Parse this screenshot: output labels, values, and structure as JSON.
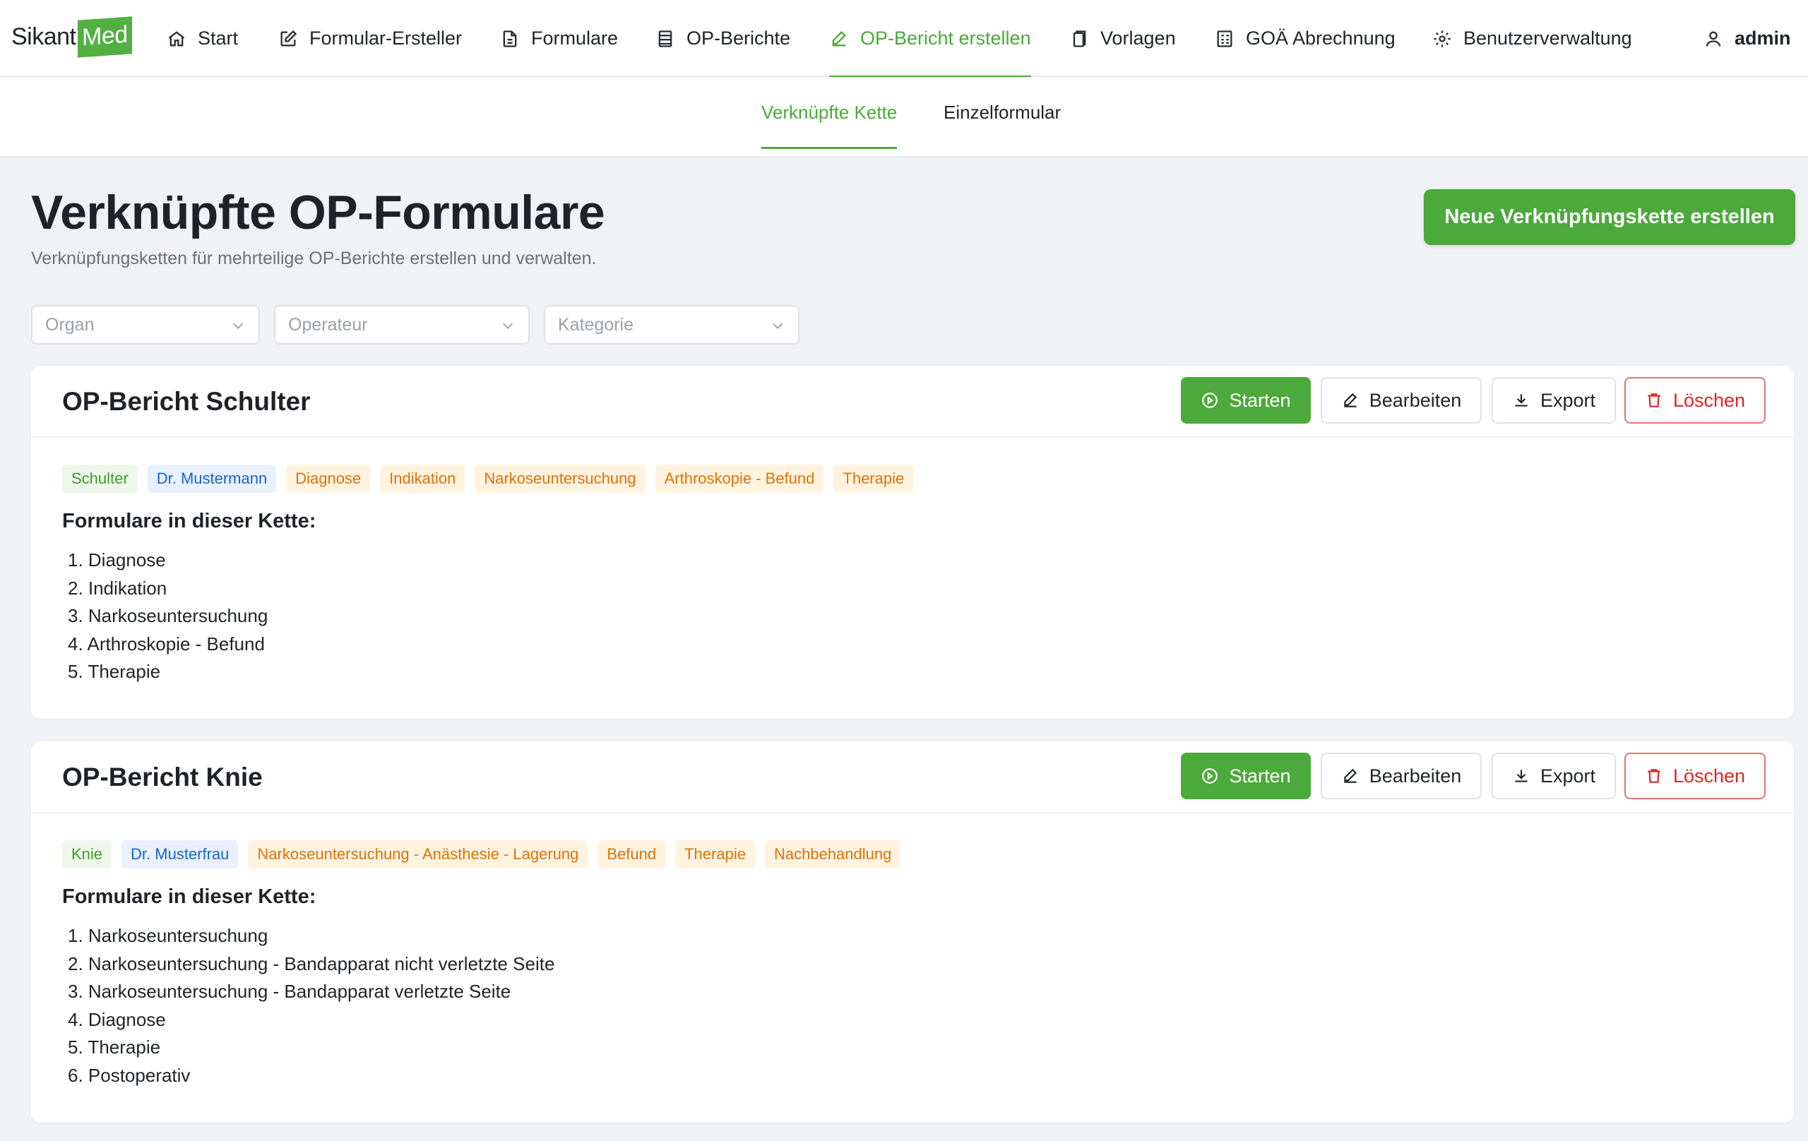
{
  "logo": {
    "part1": "Sikant",
    "part2": "Med"
  },
  "nav": {
    "items": [
      {
        "label": "Start",
        "icon": "home-icon"
      },
      {
        "label": "Formular-Ersteller",
        "icon": "edit-square-icon"
      },
      {
        "label": "Formulare",
        "icon": "document-icon"
      },
      {
        "label": "OP-Berichte",
        "icon": "list-document-icon"
      },
      {
        "label": "OP-Bericht erstellen",
        "icon": "pencil-icon"
      },
      {
        "label": "Vorlagen",
        "icon": "copy-icon"
      },
      {
        "label": "GOÄ Abrechnung",
        "icon": "calculator-icon"
      },
      {
        "label": "Benutzerverwaltung",
        "icon": "gear-icon"
      }
    ],
    "user": {
      "label": "admin",
      "icon": "user-icon"
    },
    "accent_color": "#4ca93b"
  },
  "subnav": {
    "tabs": [
      {
        "label": "Verknüpfte Kette"
      },
      {
        "label": "Einzelformular"
      }
    ]
  },
  "header": {
    "title": "Verknüpfte OP-Formulare",
    "subtitle": "Verknüpfungsketten für mehrteilige OP-Berichte erstellen und verwalten.",
    "create_button": "Neue Verknüpfungskette erstellen"
  },
  "filters": {
    "organ_placeholder": "Organ",
    "operateur_placeholder": "Operateur",
    "kategorie_placeholder": "Kategorie"
  },
  "actions": {
    "start": "Starten",
    "edit": "Bearbeiten",
    "export": "Export",
    "delete": "Löschen"
  },
  "chains": [
    {
      "title": "OP-Bericht Schulter",
      "tags": [
        {
          "label": "Schulter",
          "kind": "organ"
        },
        {
          "label": "Dr. Mustermann",
          "kind": "operateur"
        },
        {
          "label": "Diagnose",
          "kind": "kategorie"
        },
        {
          "label": "Indikation",
          "kind": "kategorie"
        },
        {
          "label": "Narkoseuntersuchung",
          "kind": "kategorie"
        },
        {
          "label": "Arthroskopie - Befund",
          "kind": "kategorie"
        },
        {
          "label": "Therapie",
          "kind": "kategorie"
        }
      ],
      "list_title": "Formulare in dieser Kette:",
      "forms": [
        "1. Diagnose",
        "2. Indikation",
        "3. Narkoseuntersuchung",
        "4. Arthroskopie - Befund",
        "5. Therapie"
      ]
    },
    {
      "title": "OP-Bericht Knie",
      "tags": [
        {
          "label": "Knie",
          "kind": "organ"
        },
        {
          "label": "Dr. Musterfrau",
          "kind": "operateur"
        },
        {
          "label": "Narkoseuntersuchung - Anästhesie - Lagerung",
          "kind": "kategorie"
        },
        {
          "label": "Befund",
          "kind": "kategorie"
        },
        {
          "label": "Therapie",
          "kind": "kategorie"
        },
        {
          "label": "Nachbehandlung",
          "kind": "kategorie"
        }
      ],
      "list_title": "Formulare in dieser Kette:",
      "forms": [
        "1. Narkoseuntersuchung",
        "2. Narkoseuntersuchung - Bandapparat nicht verletzte Seite",
        "3. Narkoseuntersuchung - Bandapparat verletzte Seite",
        "4. Diagnose",
        "5. Therapie",
        "6. Postoperativ"
      ]
    }
  ]
}
